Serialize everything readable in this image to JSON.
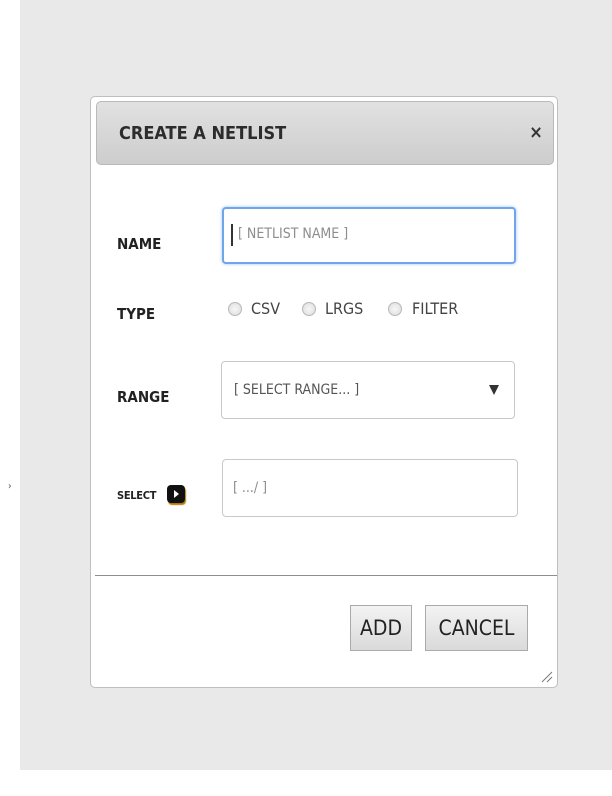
{
  "dialog": {
    "title": "CREATE A NETLIST",
    "close_icon": "×"
  },
  "form": {
    "name_label": "NAME",
    "name_placeholder": "[ NETLIST NAME ]",
    "type_label": "TYPE",
    "type_options": [
      "CSV",
      "LRGS",
      "FILTER"
    ],
    "range_label": "RANGE",
    "range_selected": "[ SELECT RANGE... ]",
    "select_label": "SELECT",
    "select_placeholder": "[ .../ ]"
  },
  "buttons": {
    "add": "ADD",
    "cancel": "CANCEL"
  },
  "colors": {
    "focus_border": "#6ea6e9",
    "titlebar": "#d6d6d6"
  },
  "icons": [
    "close-icon",
    "select-arrow-icon",
    "dropdown-arrow-icon",
    "resize-grip-icon"
  ]
}
